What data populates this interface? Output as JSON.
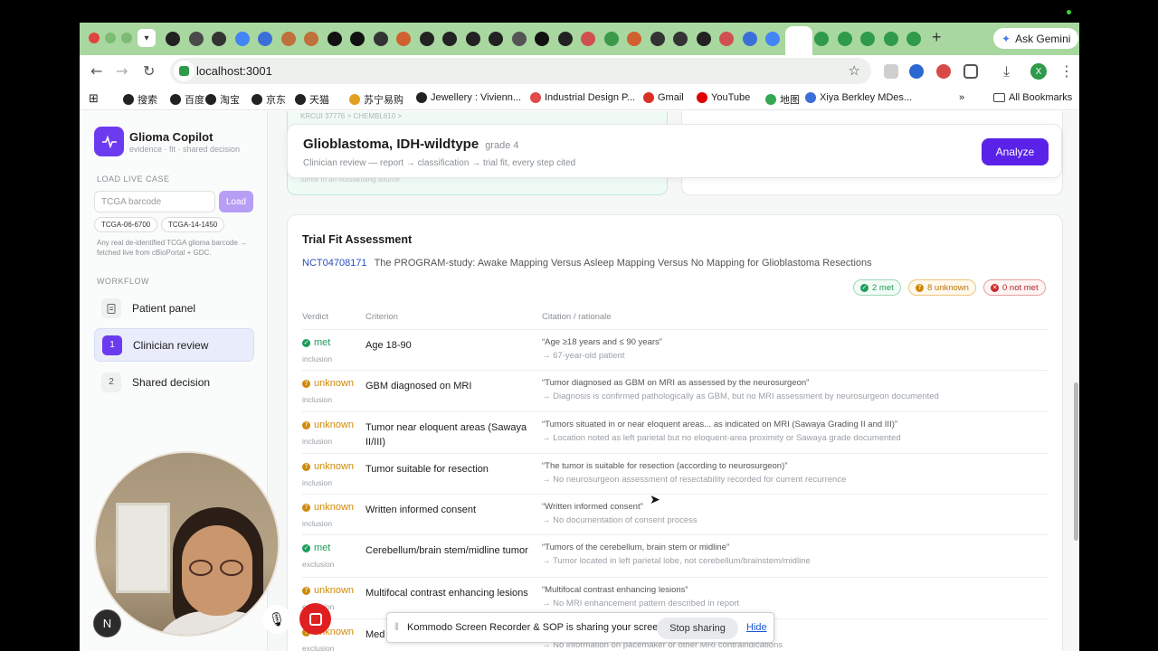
{
  "browser": {
    "url": "localhost:3001",
    "ask_gemini": "Ask Gemini",
    "profile_initial": "X",
    "tab_icons": [
      {
        "name": "github-icon",
        "color": "#222"
      },
      {
        "name": "chrome-icon",
        "color": "#4a4a4a"
      },
      {
        "name": "tab-icon",
        "color": "#333"
      },
      {
        "name": "google-icon",
        "color": "#4285f4"
      },
      {
        "name": "tab-icon",
        "color": "#3b6fd8"
      },
      {
        "name": "tab-icon",
        "color": "#c0703a"
      },
      {
        "name": "tab-icon",
        "color": "#c0703a"
      },
      {
        "name": "shield-icon",
        "color": "#111"
      },
      {
        "name": "tab-icon",
        "color": "#111"
      },
      {
        "name": "tab-icon",
        "color": "#333"
      },
      {
        "name": "asterisk-icon",
        "color": "#d06030"
      },
      {
        "name": "github-icon",
        "color": "#222"
      },
      {
        "name": "tab-icon",
        "color": "#222"
      },
      {
        "name": "tab-icon",
        "color": "#222"
      },
      {
        "name": "tab-icon",
        "color": "#222"
      },
      {
        "name": "tab-icon",
        "color": "#555"
      },
      {
        "name": "tab-icon",
        "color": "#111"
      },
      {
        "name": "github-icon",
        "color": "#222"
      },
      {
        "name": "tab-icon",
        "color": "#d05050"
      },
      {
        "name": "drive-icon",
        "color": "#3a9a4a"
      },
      {
        "name": "asterisk-icon",
        "color": "#d06030"
      },
      {
        "name": "tab-icon",
        "color": "#333"
      },
      {
        "name": "tab-icon",
        "color": "#333"
      },
      {
        "name": "github-icon",
        "color": "#222"
      },
      {
        "name": "tab-icon",
        "color": "#d05050"
      },
      {
        "name": "docs-icon",
        "color": "#3b6fd8"
      },
      {
        "name": "google-icon",
        "color": "#4285f4"
      },
      {
        "name": "record-icon",
        "color": "#d03030"
      },
      {
        "name": "tab-icon",
        "color": "#2e9a4a"
      },
      {
        "name": "tab-icon",
        "color": "#2e9a4a"
      },
      {
        "name": "tab-icon",
        "color": "#2e9a4a"
      },
      {
        "name": "tab-icon",
        "color": "#2e9a4a"
      },
      {
        "name": "tab-icon",
        "color": "#2e9a4a"
      }
    ]
  },
  "bookmarks": [
    {
      "label": "搜索",
      "color": "#222"
    },
    {
      "label": "百度",
      "color": "#222"
    },
    {
      "label": "淘宝",
      "color": "#222"
    },
    {
      "label": "京东",
      "color": "#222"
    },
    {
      "label": "天猫",
      "color": "#222"
    },
    {
      "label": "苏宁易购",
      "color": "#e0a020"
    },
    {
      "label": "Jewellery : Vivienn...",
      "color": "#222"
    },
    {
      "label": "Industrial Design P...",
      "color": "#e04a4a"
    },
    {
      "label": "Gmail",
      "color": "#d93025"
    },
    {
      "label": "YouTube",
      "color": "#e00000"
    },
    {
      "label": "地图",
      "color": "#34a853"
    },
    {
      "label": "Xiya Berkley MDes...",
      "color": "#3b6fd8"
    }
  ],
  "all_bookmarks": "All Bookmarks",
  "sidebar": {
    "title": "Glioma Copilot",
    "subtitle": "evidence · fit · shared decision",
    "load_label": "LOAD LIVE CASE",
    "barcode_placeholder": "TCGA barcode",
    "load_button": "Load",
    "cases": [
      "TCGA-06-6700",
      "TCGA-14-1450"
    ],
    "note": "Any real de-identified TCGA glioma barcode → fetched live from cBioPortal + GDC.",
    "workflow_label": "WORKFLOW",
    "workflow": [
      {
        "badge": "",
        "label": "Patient panel"
      },
      {
        "badge": "1",
        "label": "Clinician review"
      },
      {
        "badge": "2",
        "label": "Shared decision"
      }
    ]
  },
  "prev_card": {
    "crumb": "KRCUI 37776 >  CHEMBL610 >",
    "fade": "tumor in an outstanding source"
  },
  "diagnosis": {
    "title": "Glioblastoma, IDH-wildtype",
    "grade": "grade 4",
    "subtitle": "Clinician review — report → classification → trial fit, every step cited",
    "analyze": "Analyze"
  },
  "trial": {
    "heading": "Trial Fit Assessment",
    "nct": "NCT04708171",
    "name": "The PROGRAM-study: Awake Mapping Versus Asleep Mapping Versus No Mapping for Glioblastoma Resections",
    "summary": {
      "met": "2 met",
      "unknown": "8 unknown",
      "not_met": "0 not met"
    },
    "columns": {
      "verdict": "Verdict",
      "criterion": "Criterion",
      "citation": "Citation / rationale"
    },
    "rows": [
      {
        "verdict": "met",
        "kind": "inclusion",
        "criterion": "Age 18-90",
        "cite": "“Age ≥18 years and ≤ 90 years”",
        "why": "→ 67-year-old patient"
      },
      {
        "verdict": "unknown",
        "kind": "inclusion",
        "criterion": "GBM diagnosed on MRI",
        "cite": "“Tumor diagnosed as GBM on MRI as assessed by the neurosurgeon”",
        "why": "→ Diagnosis is confirmed pathologically as GBM, but no MRI assessment by neurosurgeon documented"
      },
      {
        "verdict": "unknown",
        "kind": "inclusion",
        "criterion": "Tumor near eloquent areas (Sawaya II/III)",
        "cite": "“Tumors situated in or near eloquent areas... as indicated on MRI (Sawaya Grading II and III)”",
        "why": "→ Location noted as left parietal but no eloquent-area proximity or Sawaya grade documented"
      },
      {
        "verdict": "unknown",
        "kind": "inclusion",
        "criterion": "Tumor suitable for resection",
        "cite": "“The tumor is suitable for resection (according to neurosurgeon)”",
        "why": "→ No neurosurgeon assessment of resectability recorded for current recurrence"
      },
      {
        "verdict": "unknown",
        "kind": "inclusion",
        "criterion": "Written informed consent",
        "cite": "“Written informed consent”",
        "why": "→ No documentation of consent process"
      },
      {
        "verdict": "met",
        "kind": "exclusion",
        "criterion": "Cerebellum/brain stem/midline tumor",
        "cite": "“Tumors of the cerebellum, brain stem or midline”",
        "why": "→ Tumor located in left parietal lobe, not cerebellum/brainstem/midline"
      },
      {
        "verdict": "unknown",
        "kind": "exclusion",
        "criterion": "Multifocal contrast enhancing lesions",
        "cite": "“Multifocal contrast enhancing lesions”",
        "why": "→ No MRI enhancement pattern described in report"
      },
      {
        "verdict": "unknown",
        "kind": "exclusion",
        "criterion": "Med",
        "cite": "",
        "why": "→ No information on pacemaker or other MRI contraindications"
      }
    ]
  },
  "overlay": {
    "share_text": "Kommodo Screen Recorder & SOP is sharing your screen.",
    "stop_sharing": "Stop sharing",
    "hide": "Hide",
    "n_initial": "N"
  },
  "colors": {
    "accent": "#5a22e8",
    "met": "#1f9d5a",
    "unknown": "#d08a0a",
    "not_met": "#c62828",
    "tabstrip": "#a9d7a0"
  }
}
